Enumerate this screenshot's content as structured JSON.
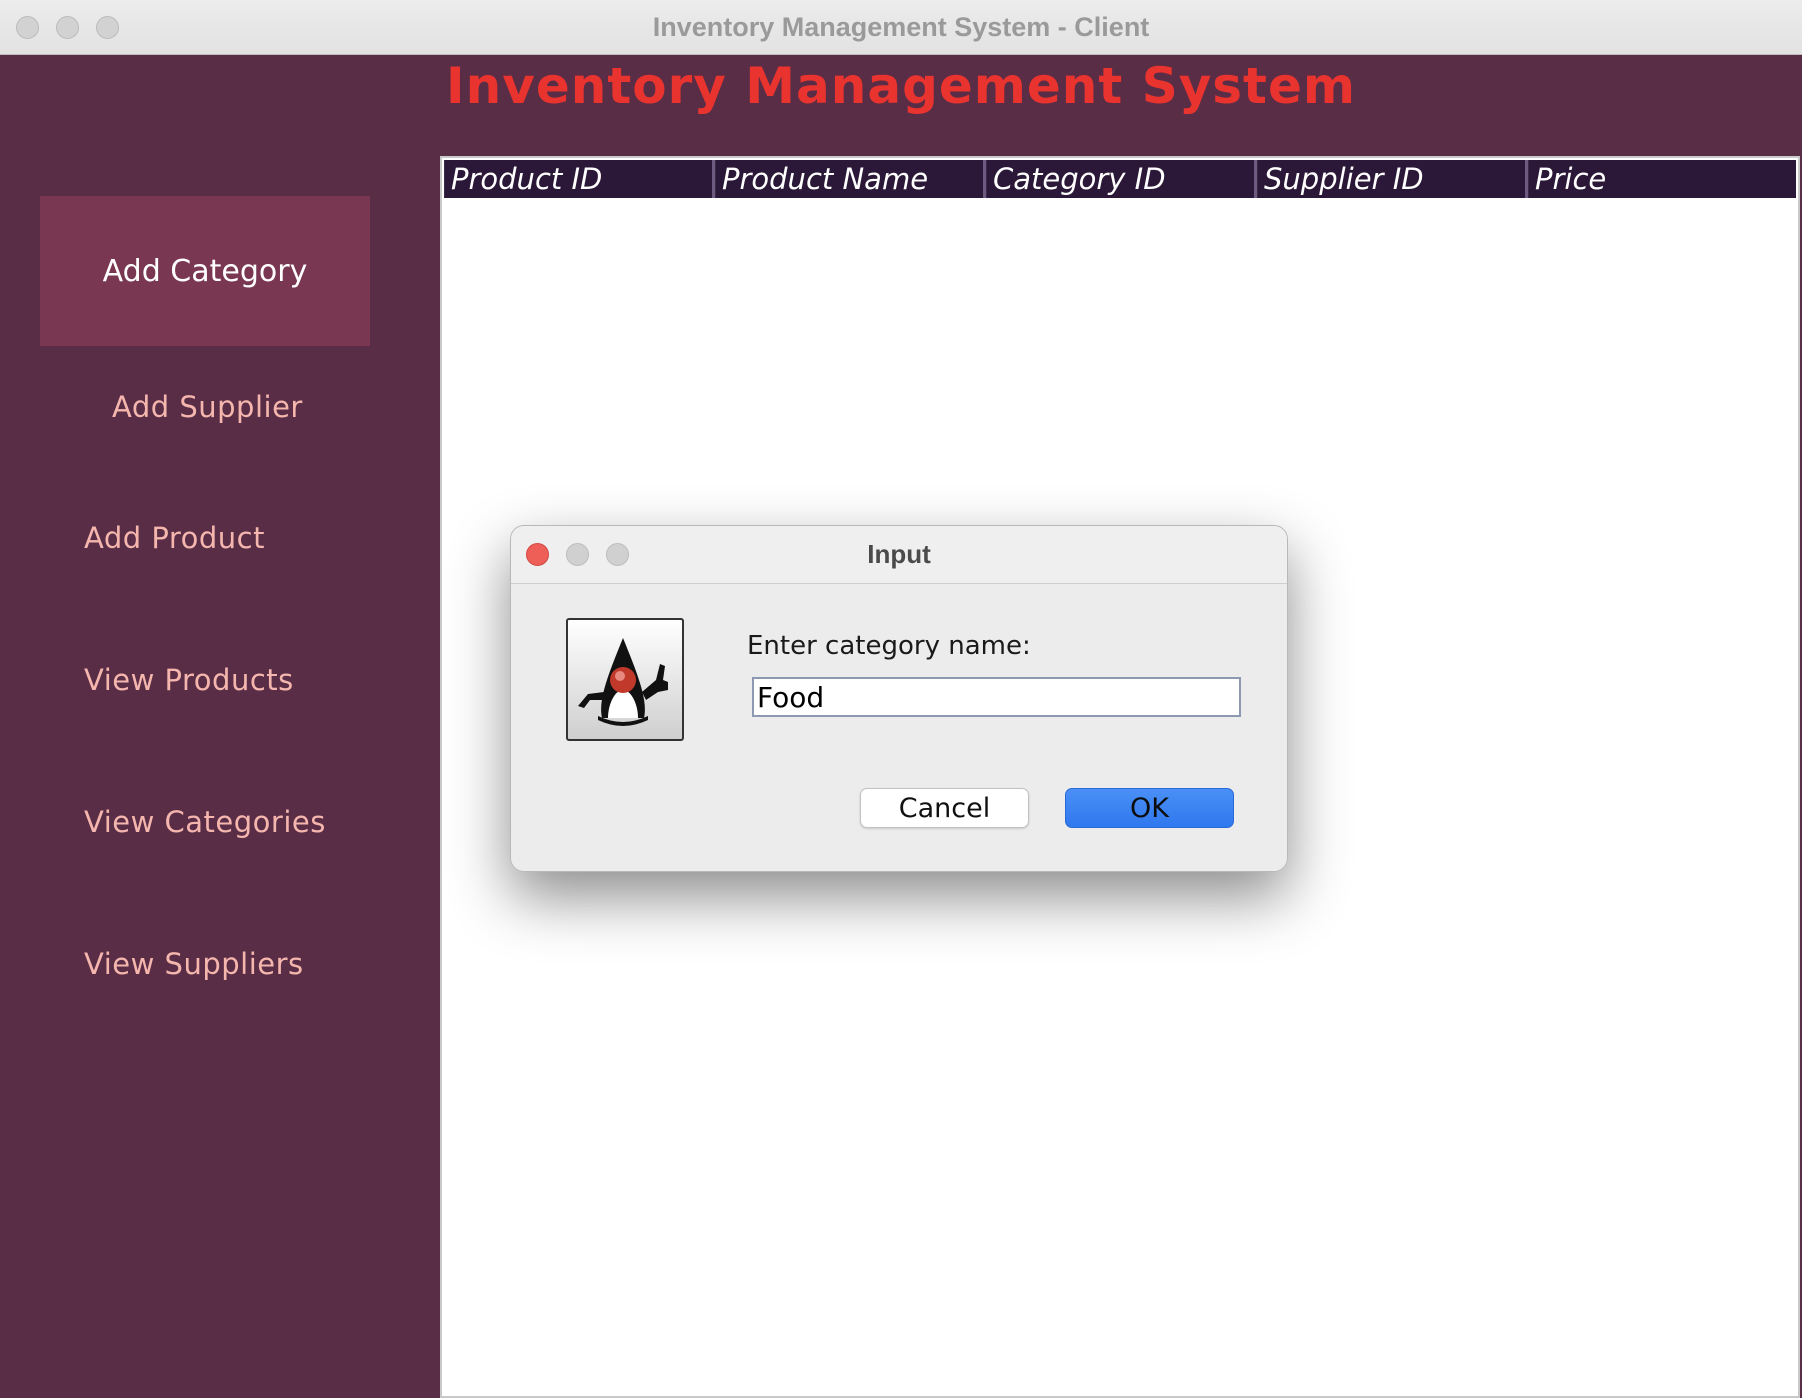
{
  "window": {
    "title": "Inventory Management System - Client"
  },
  "app": {
    "title": "Inventory Management System"
  },
  "sidebar": {
    "items": [
      {
        "label": "Add Category"
      },
      {
        "label": "Add Supplier"
      },
      {
        "label": "Add Product"
      },
      {
        "label": "View Products"
      },
      {
        "label": "View Categories"
      },
      {
        "label": "View Suppliers"
      }
    ],
    "active_index": 0
  },
  "table": {
    "columns": [
      "Product ID",
      "Product Name",
      "Category ID",
      "Supplier ID",
      "Price"
    ],
    "rows": []
  },
  "dialog": {
    "title": "Input",
    "prompt": "Enter category name:",
    "input_value": "Food",
    "cancel_label": "Cancel",
    "ok_label": "OK",
    "icon": "java-duke-icon"
  },
  "colors": {
    "app_background": "#592d46",
    "title_color": "#e8332f",
    "sidebar_text": "#f5b6ae",
    "active_item_bg": "#7a3752",
    "table_header_bg": "#2b1838",
    "ok_button": "#3a82f2"
  }
}
